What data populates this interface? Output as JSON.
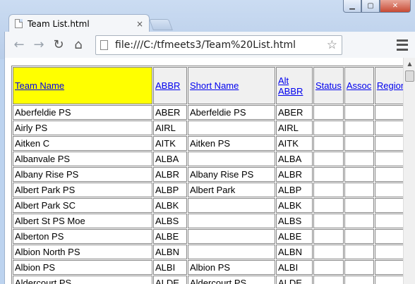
{
  "window": {
    "minimize": "▁",
    "maximize": "▢",
    "close": "✕"
  },
  "tab": {
    "title": "Team List.html",
    "close": "×"
  },
  "toolbar": {
    "back": "←",
    "forward": "→",
    "reload": "↻",
    "home": "⌂",
    "url": "file:///C:/tfmeets3/Team%20List.html",
    "star": "☆"
  },
  "table": {
    "headers": [
      "Team Name",
      "ABBR",
      "Short Name",
      "Alt ABBR",
      "Status",
      "Assoc",
      "Region"
    ],
    "rows": [
      [
        "Aberfeldie PS",
        "ABER",
        "Aberfeldie PS",
        "ABER"
      ],
      [
        "Airly PS",
        "AIRL",
        "",
        "AIRL"
      ],
      [
        "Aitken C",
        "AITK",
        "Aitken PS",
        "AITK"
      ],
      [
        "Albanvale PS",
        "ALBA",
        "",
        "ALBA"
      ],
      [
        "Albany Rise PS",
        "ALBR",
        "Albany Rise PS",
        "ALBR"
      ],
      [
        "Albert Park PS",
        "ALBP",
        "Albert Park",
        "ALBP"
      ],
      [
        "Albert Park SC",
        "ALBK",
        "",
        "ALBK"
      ],
      [
        "Albert St PS Moe",
        "ALBS",
        "",
        "ALBS"
      ],
      [
        "Alberton PS",
        "ALBE",
        "",
        "ALBE"
      ],
      [
        "Albion North PS",
        "ALBN",
        "",
        "ALBN"
      ],
      [
        "Albion PS",
        "ALBI",
        "Albion PS",
        "ALBI"
      ],
      [
        "Aldercourt PS",
        "ALDE",
        "Aldercourt PS",
        "ALDE"
      ]
    ]
  }
}
